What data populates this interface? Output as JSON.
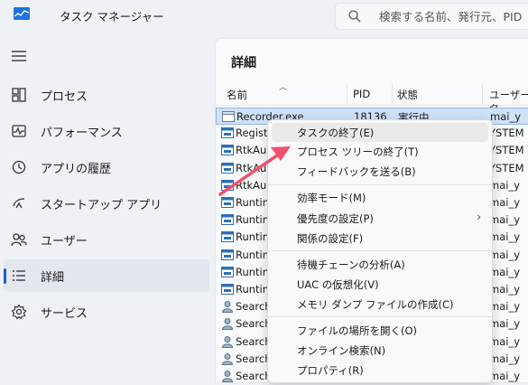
{
  "app": {
    "title": "タスク マネージャー",
    "icon": "task-manager-icon"
  },
  "search": {
    "placeholder": "検索する名前、発行元、PID"
  },
  "nav": {
    "items": [
      {
        "label": "プロセス",
        "icon": "processes-icon"
      },
      {
        "label": "パフォーマンス",
        "icon": "performance-icon"
      },
      {
        "label": "アプリの履歴",
        "icon": "app-history-icon"
      },
      {
        "label": "スタートアップ アプリ",
        "icon": "startup-apps-icon"
      },
      {
        "label": "ユーザー",
        "icon": "users-icon"
      },
      {
        "label": "詳細",
        "icon": "details-icon",
        "active": true
      },
      {
        "label": "サービス",
        "icon": "services-icon"
      }
    ]
  },
  "details": {
    "title": "詳細",
    "columns": {
      "name": "名前",
      "pid": "PID",
      "status": "状態",
      "user": "ユーザー名"
    },
    "rows": [
      {
        "name": "Recorder.exe",
        "pid": "18136",
        "status": "実行中",
        "user": "mai_y",
        "selected": true
      },
      {
        "name": "Regist",
        "user": "YSTEM"
      },
      {
        "name": "RtkAu",
        "user": "YSTEM"
      },
      {
        "name": "RtkAu",
        "user": "YSTEM"
      },
      {
        "name": "RtkAu",
        "user": "mai_y"
      },
      {
        "name": "Runtin",
        "user": "mai_y"
      },
      {
        "name": "Runtin",
        "user": "mai_y"
      },
      {
        "name": "Runtin",
        "user": "mai_y"
      },
      {
        "name": "Runtin",
        "user": "mai_y"
      },
      {
        "name": "Runtin",
        "user": "mai_y"
      },
      {
        "name": "Runtin",
        "user": "mai_y"
      },
      {
        "name": "Search",
        "user": "mai_y"
      },
      {
        "name": "Search",
        "user": "mai_y"
      },
      {
        "name": "Search",
        "user": "mai_y"
      },
      {
        "name": "Search",
        "user": "mai_y"
      },
      {
        "name": "Search",
        "user": "mai_y"
      }
    ]
  },
  "context_menu": {
    "items": [
      {
        "label": "タスクの終了(E)",
        "hover": true
      },
      {
        "label": "プロセス ツリーの終了(T)"
      },
      {
        "label": "フィードバックを送る(B)"
      },
      {
        "label": "効率モード(M)"
      },
      {
        "label": "優先度の設定(P)",
        "submenu": true
      },
      {
        "label": "関係の設定(F)"
      },
      {
        "label": "待機チェーンの分析(A)"
      },
      {
        "label": "UAC の仮想化(V)"
      },
      {
        "label": "メモリ ダンプ ファイルの作成(C)"
      },
      {
        "label": "ファイルの場所を開く(O)"
      },
      {
        "label": "オンライン検索(N)"
      },
      {
        "label": "プロパティ(R)"
      }
    ]
  },
  "annotation": {
    "arrow_color": "#f0506e",
    "icon": "pointer-arrow-icon"
  }
}
